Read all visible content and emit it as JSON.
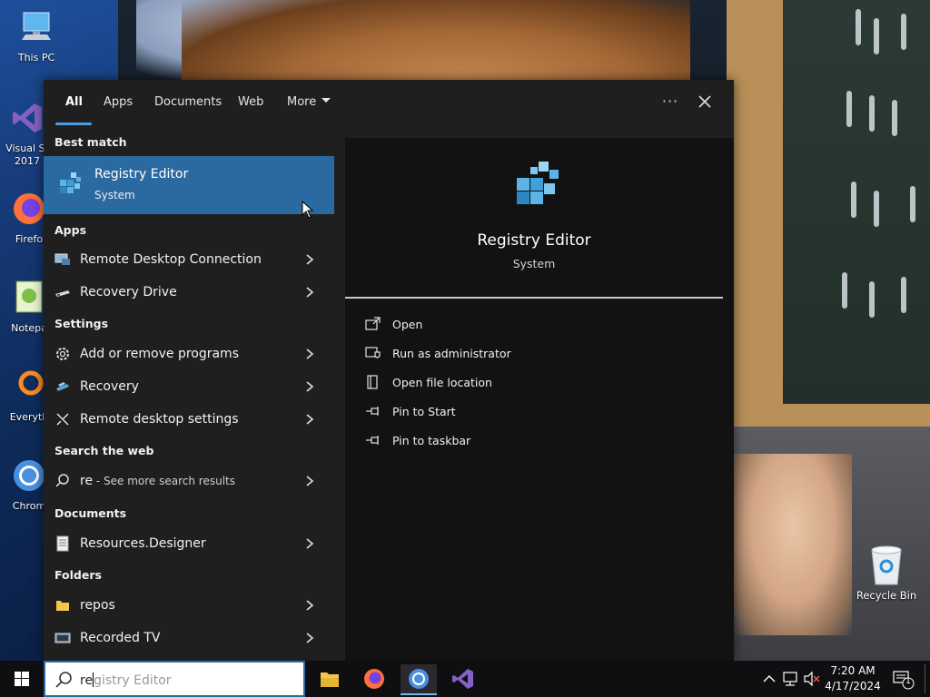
{
  "desktop": {
    "icons": [
      {
        "label": "This PC",
        "icon": "computer-icon"
      },
      {
        "label": "Visual St 2017",
        "icon": "visual-studio-icon"
      },
      {
        "label": "Firefo",
        "icon": "firefox-icon"
      },
      {
        "label": "Notepa",
        "icon": "notepad-icon"
      },
      {
        "label": "Everyth",
        "icon": "everything-search-icon"
      },
      {
        "label": "Chrom",
        "icon": "chrome-icon"
      }
    ],
    "recycle_bin": {
      "label": "Recycle Bin",
      "icon": "recycle-bin-icon"
    }
  },
  "search_panel": {
    "tabs": [
      {
        "label": "All",
        "active": true
      },
      {
        "label": "Apps"
      },
      {
        "label": "Documents"
      },
      {
        "label": "Web"
      },
      {
        "label": "More"
      }
    ],
    "more_options_label": "···",
    "best_match": {
      "heading": "Best match",
      "title": "Registry Editor",
      "subtitle": "System"
    },
    "sections": {
      "apps": "Apps",
      "settings": "Settings",
      "web": "Search the web",
      "documents": "Documents",
      "folders": "Folders"
    },
    "apps": [
      {
        "label": "Remote Desktop Connection",
        "icon": "remote-desktop-icon"
      },
      {
        "label": "Recovery Drive",
        "icon": "recovery-drive-icon"
      }
    ],
    "settings": [
      {
        "label": "Add or remove programs",
        "icon": "gear-icon"
      },
      {
        "label": "Recovery",
        "icon": "recovery-icon"
      },
      {
        "label": "Remote desktop settings",
        "icon": "remote-settings-icon"
      }
    ],
    "web": {
      "query": "re",
      "hint": "See more search results",
      "separator": " - "
    },
    "documents": [
      {
        "label": "Resources.Designer",
        "icon": "document-icon"
      }
    ],
    "folders": [
      {
        "label": "repos",
        "icon": "folder-icon"
      },
      {
        "label": "Recorded TV",
        "icon": "tv-folder-icon"
      }
    ],
    "preview": {
      "title": "Registry Editor",
      "subtitle": "System",
      "actions": [
        {
          "label": "Open",
          "icon": "open-icon"
        },
        {
          "label": "Run as administrator",
          "icon": "shield-icon"
        },
        {
          "label": "Open file location",
          "icon": "file-location-icon"
        },
        {
          "label": "Pin to Start",
          "icon": "pin-icon"
        },
        {
          "label": "Pin to taskbar",
          "icon": "pin-icon"
        }
      ]
    }
  },
  "taskbar": {
    "search": {
      "typed": "re",
      "suggestion": "gistry Editor"
    },
    "pinned": [
      "file-explorer-icon",
      "firefox-icon",
      "chrome-icon",
      "visual-studio-icon"
    ],
    "clock": {
      "time": "7:20 AM",
      "date": "4/17/2024"
    },
    "notifications_count": "1"
  },
  "colors": {
    "accent": "#2b6aa0",
    "tab_underline": "#4c9be8",
    "panel_bg": "#1f1f1f",
    "preview_bg": "#121212"
  }
}
